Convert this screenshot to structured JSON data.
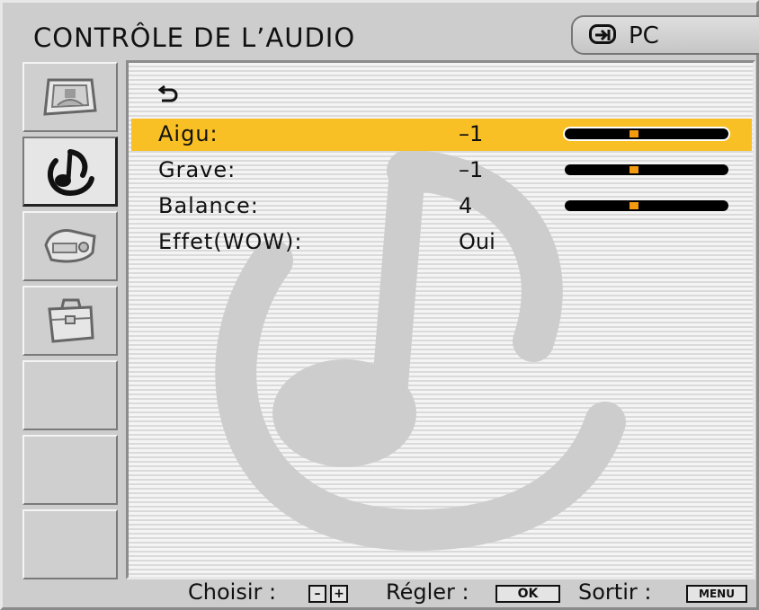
{
  "header": {
    "title": "CONTRÔLE DE L’AUDIO",
    "source_label": "PC",
    "source_icon": "input-source-icon"
  },
  "sidebar": {
    "items": [
      {
        "name": "image-menu",
        "icon": "picture-icon",
        "active": false
      },
      {
        "name": "audio-menu",
        "icon": "music-note-icon",
        "active": true
      },
      {
        "name": "setup-menu",
        "icon": "projector-icon",
        "active": false
      },
      {
        "name": "tools-menu",
        "icon": "toolbox-icon",
        "active": false
      },
      {
        "name": "empty-1",
        "icon": "",
        "active": false
      },
      {
        "name": "empty-2",
        "icon": "",
        "active": false
      },
      {
        "name": "empty-3",
        "icon": "",
        "active": false
      }
    ]
  },
  "menu": {
    "back_icon": "back-arrow-icon",
    "rows": [
      {
        "label": "Aigu:",
        "value": "–1",
        "slider": 0.42,
        "selected": true
      },
      {
        "label": "Grave:",
        "value": "–1",
        "slider": 0.42,
        "selected": false
      },
      {
        "label": "Balance:",
        "value": "4",
        "slider": 0.42,
        "selected": false
      },
      {
        "label": "Effet(WOW):",
        "value": "Oui",
        "selected": false
      }
    ]
  },
  "footer": {
    "choose_label": "Choisir :",
    "minus_key": "–",
    "plus_key": "+",
    "adjust_label": "Régler :",
    "ok_key": "OK",
    "exit_label": "Sortir :",
    "menu_key": "MENU"
  },
  "colors": {
    "highlight": "#f8c025",
    "slider_knob": "#f39a10"
  }
}
